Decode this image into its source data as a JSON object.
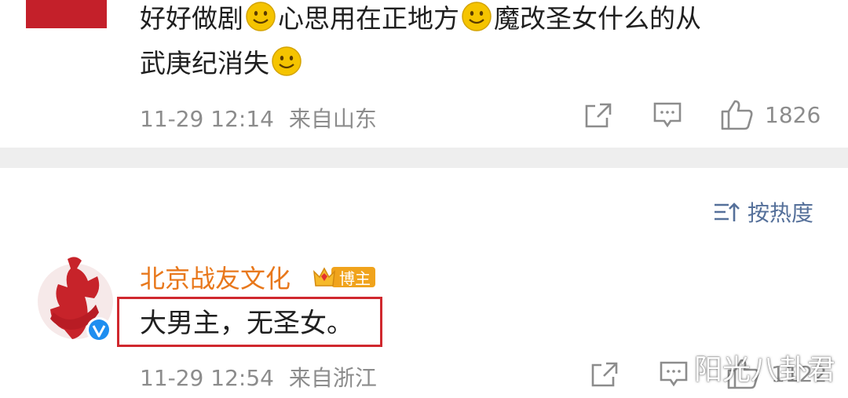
{
  "comment1": {
    "text_line1_part1": "好好做剧",
    "text_line1_part2": "心思用在正地方",
    "text_line1_part3": "魔改圣女什么的从",
    "text_line2": "武庚纪消失",
    "time": "11-29 12:14",
    "location": "来自山东",
    "like_count": "1826"
  },
  "sort": {
    "label": "按热度"
  },
  "comment2": {
    "username": "北京战友文化",
    "badge_label": "博主",
    "text": "大男主，无圣女。",
    "time": "11-29 12:54",
    "location": "来自浙江",
    "like_count": "1122"
  },
  "watermark": "阳光八卦君",
  "colors": {
    "accent_username": "#e8781c",
    "sort_link": "#55709a",
    "highlight_box": "#d0282e"
  },
  "icons": [
    "share-icon",
    "comment-icon",
    "like-icon",
    "sort-icon",
    "smile-emoji-icon",
    "verified-icon",
    "crown-icon"
  ]
}
